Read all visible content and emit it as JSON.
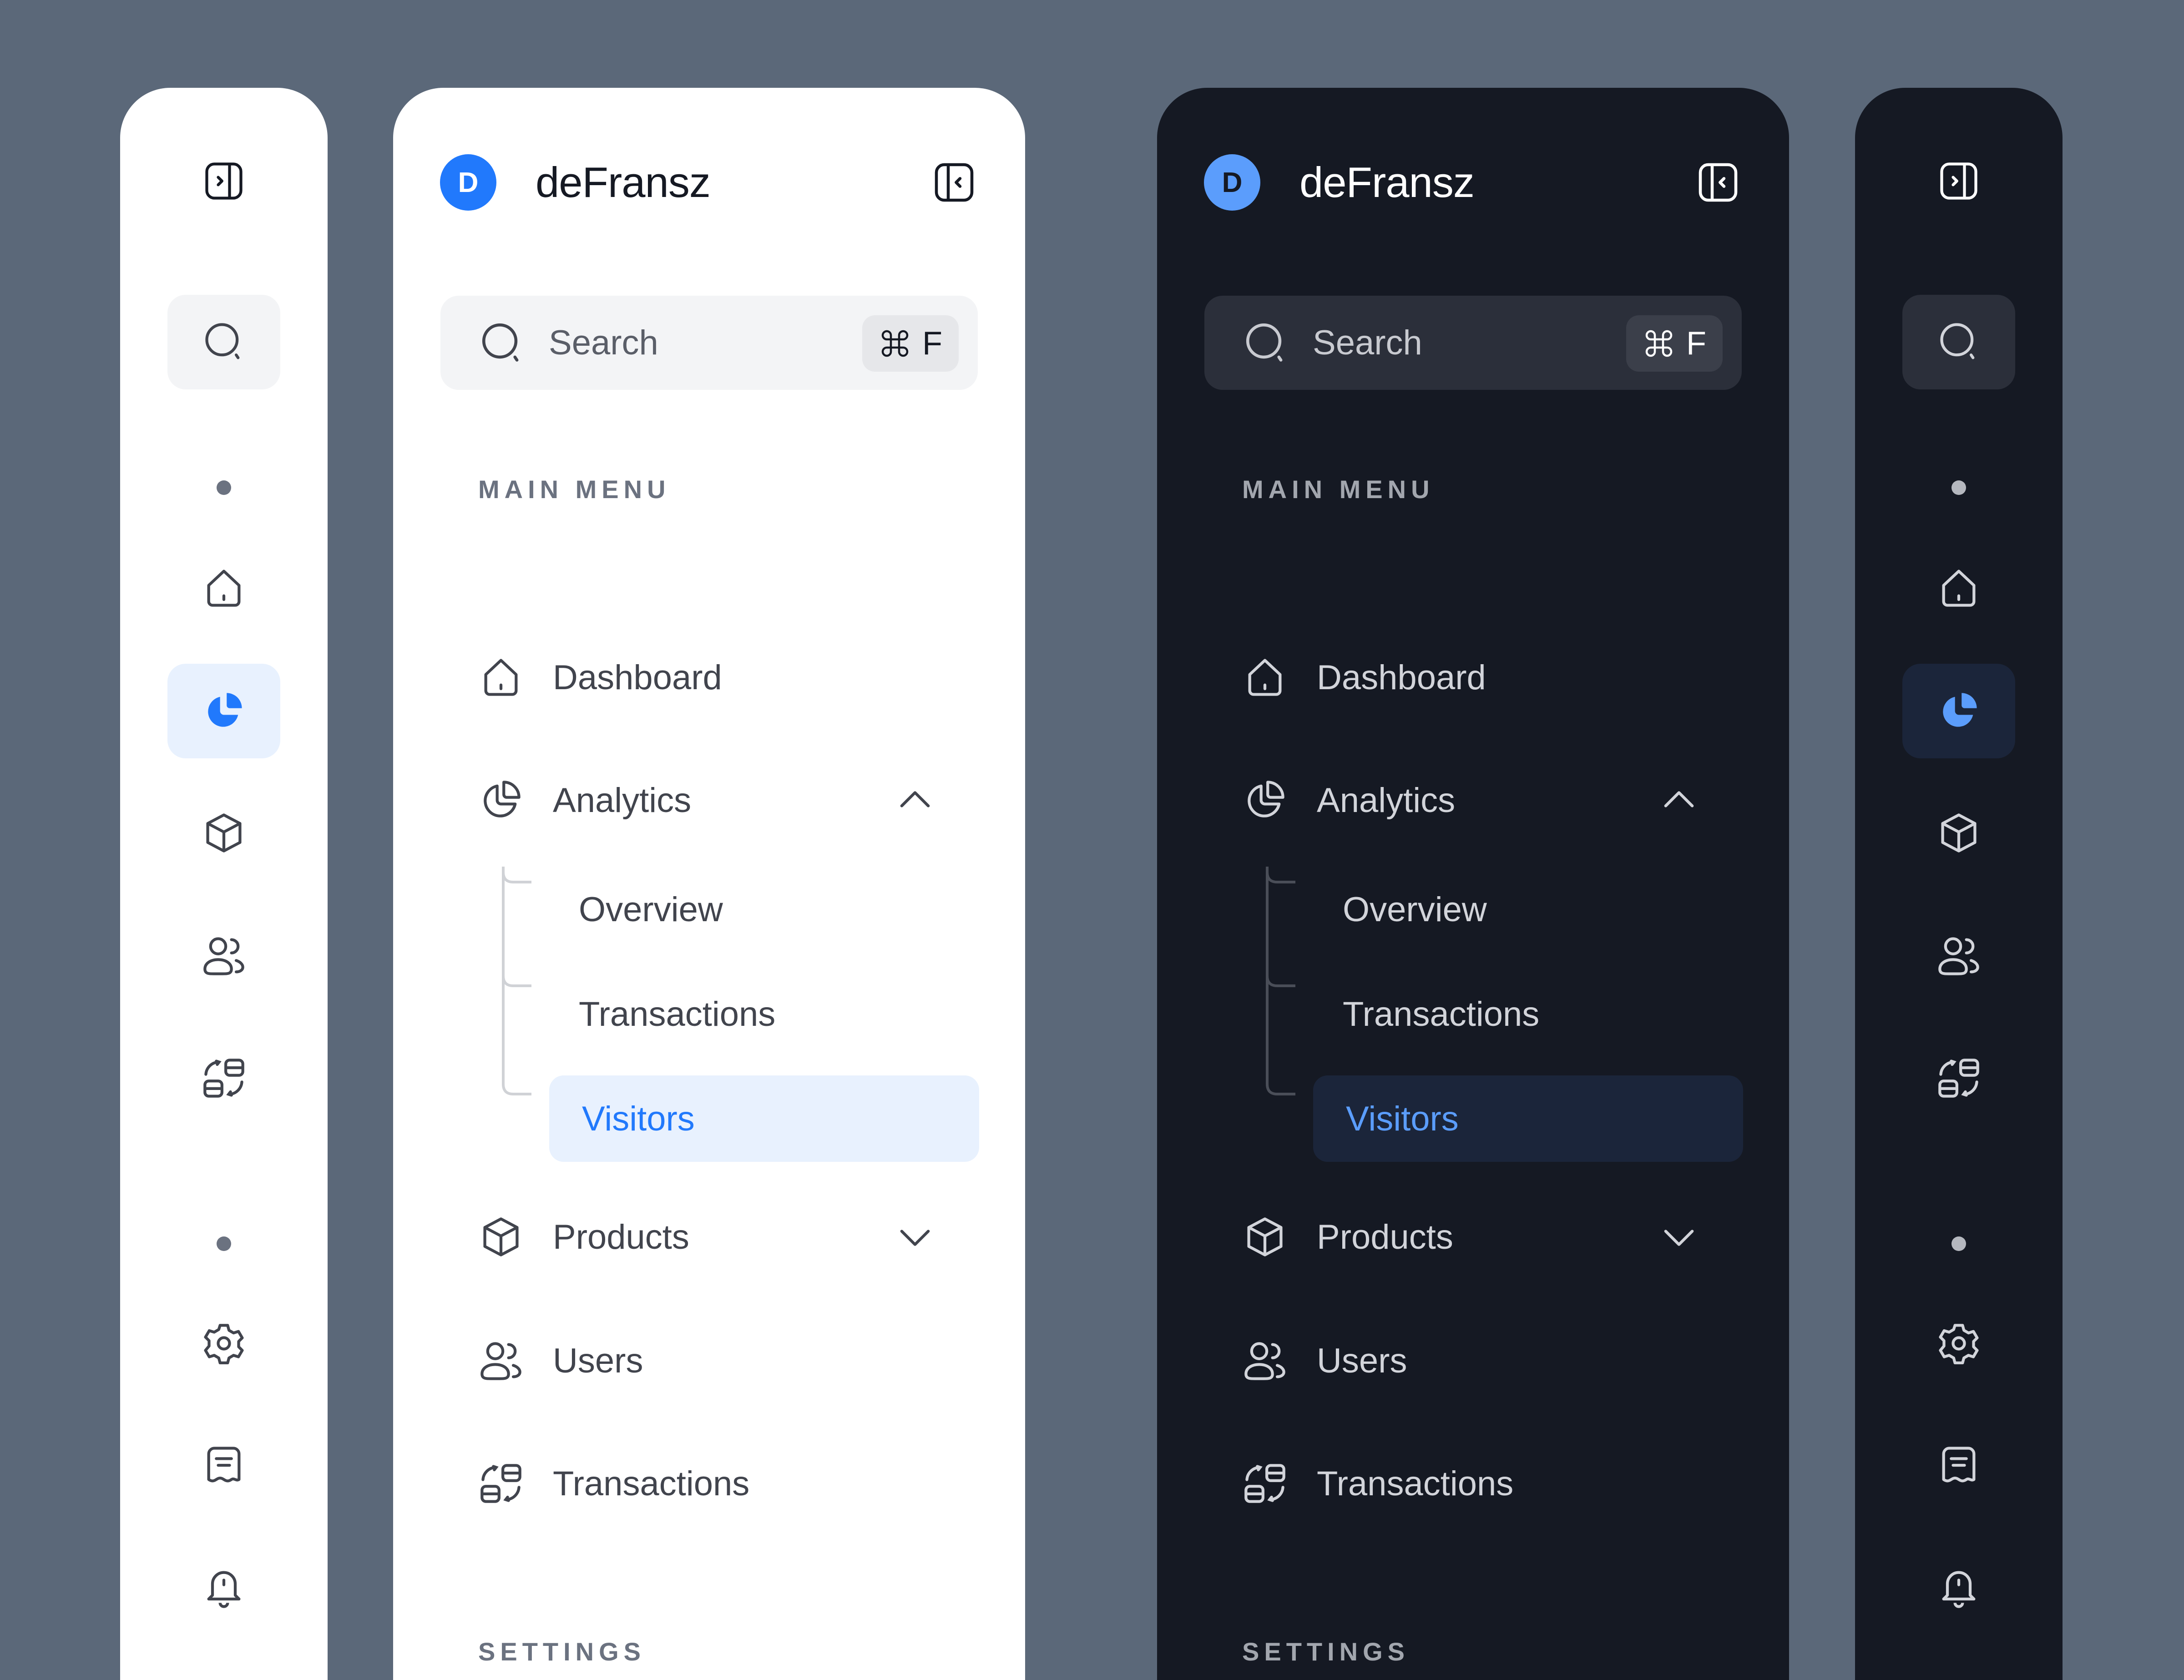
{
  "theme_variants": [
    "light",
    "dark"
  ],
  "colors": {
    "accent_light": "#2179fc",
    "accent_dark": "#5b9dfc",
    "background": "#5b6879",
    "panel_light": "#ffffff",
    "panel_dark": "#151923",
    "active_bg_light": "#e8f1fe",
    "active_bg_dark": "#1b253a"
  },
  "brand": {
    "avatar_letter": "D",
    "name": "deFransz"
  },
  "search": {
    "placeholder": "Search",
    "shortcut_symbol": "⌘",
    "shortcut_key": "F"
  },
  "sections": {
    "main": "MAIN MENU",
    "settings": "SETTINGS"
  },
  "menu": [
    {
      "label": "Dashboard",
      "icon": "home-icon"
    },
    {
      "label": "Analytics",
      "icon": "pie-chart-icon",
      "expanded": true,
      "children": [
        {
          "label": "Overview"
        },
        {
          "label": "Transactions"
        },
        {
          "label": "Visitors",
          "active": true
        }
      ]
    },
    {
      "label": "Products",
      "icon": "box-icon",
      "expanded": false
    },
    {
      "label": "Users",
      "icon": "users-icon"
    },
    {
      "label": "Transactions",
      "icon": "transactions-icon"
    }
  ],
  "rail": {
    "icons": [
      "expand-sidebar-icon",
      "search-icon",
      "home-icon",
      "pie-chart-icon",
      "box-icon",
      "users-icon",
      "transactions-icon",
      "gear-icon",
      "receipt-icon",
      "bell-icon"
    ],
    "active": "pie-chart-icon"
  }
}
